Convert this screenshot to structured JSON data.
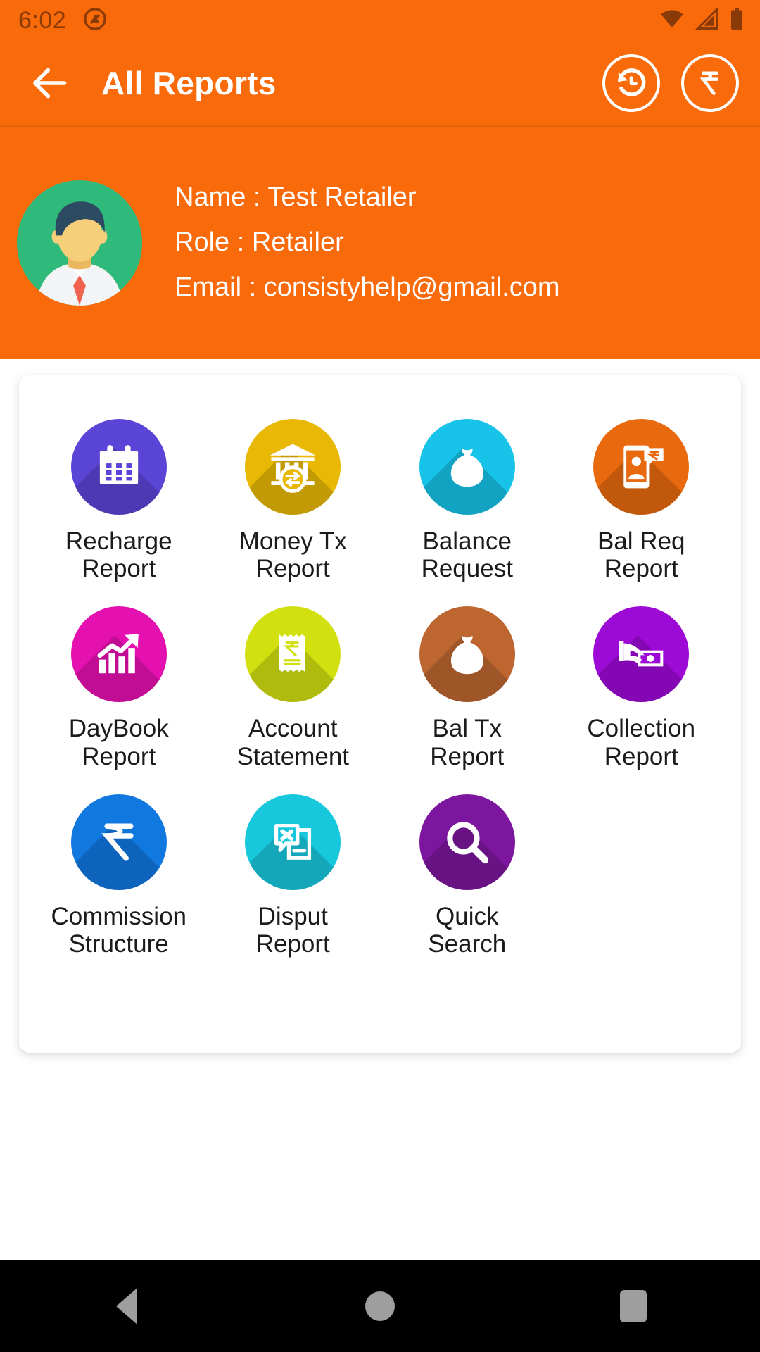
{
  "status_bar": {
    "time": "6:02",
    "notification_icon": "circle-slash-notification-icon",
    "wifi_icon": "wifi-icon",
    "signal_icon": "cellular-signal-icon",
    "battery_icon": "battery-full-icon",
    "icon_color": "#8a3a06"
  },
  "app_bar": {
    "back_icon": "arrow-left-icon",
    "title": "All Reports",
    "history_icon": "history-restore-icon",
    "rupee_icon": "rupee-icon",
    "background": "#F96A0B"
  },
  "profile": {
    "avatar_icon": "user-avatar-icon",
    "avatar_background": "#2fb97a",
    "name_line": "Name : Test Retailer",
    "role_line": "Role : Retailer",
    "email_line": "Email : consistyhelp@gmail.com"
  },
  "reports": {
    "items": [
      {
        "label": "Recharge\nReport",
        "icon": "calendar-icon",
        "color": "#5b45d6"
      },
      {
        "label": "Money Tx\nReport",
        "icon": "bank-exchange-icon",
        "color": "#e8b804"
      },
      {
        "label": "Balance\nRequest",
        "icon": "money-bag-icon",
        "color": "#17c3e8"
      },
      {
        "label": "Bal Req\nReport",
        "icon": "mobile-request-icon",
        "color": "#e8690e"
      },
      {
        "label": "DayBook\nReport",
        "icon": "bar-chart-growth-icon",
        "color": "#e510b0"
      },
      {
        "label": "Account\nStatement",
        "icon": "receipt-rupee-icon",
        "color": "#d2e010"
      },
      {
        "label": "Bal Tx\nReport",
        "icon": "money-bag-icon",
        "color": "#bd6630"
      },
      {
        "label": "Collection\nReport",
        "icon": "hand-cash-icon",
        "color": "#9d0ad6"
      },
      {
        "label": "Commission\nStructure",
        "icon": "rupee-symbol-icon",
        "color": "#1178e0"
      },
      {
        "label": "Disput\nReport",
        "icon": "dispute-document-icon",
        "color": "#17c8dd"
      },
      {
        "label": "Quick\nSearch",
        "icon": "magnifier-icon",
        "color": "#7d169e"
      }
    ]
  },
  "nav_bar": {
    "back_label": "Back",
    "home_label": "Home",
    "recents_label": "Recents",
    "background": "#000000",
    "icon_color": "#9e9e9e"
  }
}
